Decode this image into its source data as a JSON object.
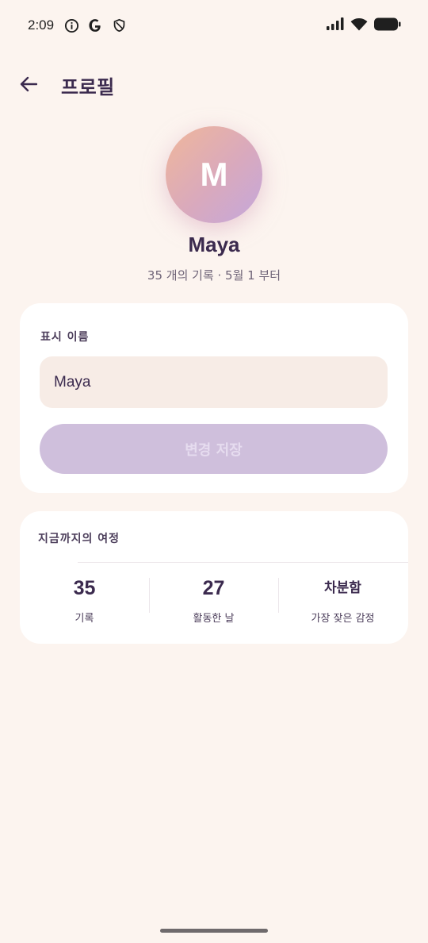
{
  "status_bar": {
    "time": "2:09",
    "icons_left": [
      "info-icon",
      "google-icon",
      "shield-icon"
    ],
    "icons_right": [
      "signal-icon",
      "wifi-icon",
      "battery-icon"
    ]
  },
  "header": {
    "title": "프로필",
    "back_icon": "arrow-left-icon"
  },
  "profile": {
    "avatar_letter": "M",
    "name": "Maya",
    "meta": "35 개의 기록 · 5월 1 부터"
  },
  "name_card": {
    "label": "표시 이름",
    "input_value": "Maya",
    "save_label": "변경 저장"
  },
  "stats_card": {
    "title": "지금까지의 여정",
    "stats": [
      {
        "value": "35",
        "label": "기록"
      },
      {
        "value": "27",
        "label": "활동한 날"
      },
      {
        "value": "차분함",
        "label": "가장 잦은 감정"
      }
    ]
  },
  "colors": {
    "background": "#fcf4ef",
    "primary_text": "#3b2a4e",
    "save_button_disabled": "#cfbfdc",
    "input_background": "#f7ece6"
  }
}
